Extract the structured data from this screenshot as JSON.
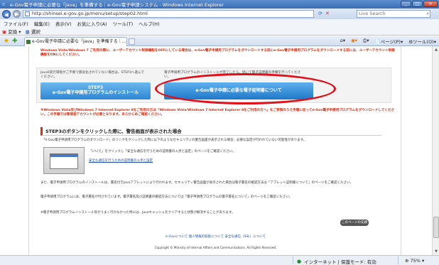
{
  "window": {
    "title": "e-Gov電子申請に必要な「Java」を準備する｜e-Gov電子申請システム - Windows Internet Explorer",
    "minimize": "_",
    "maximize": "□",
    "close": "✕"
  },
  "address": {
    "url": "http://shinsei.e-gov.go.jp/menu/setup/step02.html",
    "search_placeholder": "Live Search"
  },
  "menubar": {
    "items": [
      "ファイル(F)",
      "編集(E)",
      "表示(V)",
      "お気に入り(A)",
      "ツール(T)",
      "ヘルプ(H)"
    ]
  },
  "cmdrow": {
    "convert": "変換",
    "select": "選択"
  },
  "tabs": {
    "active_label": "e-Gov電子申請に必要な「Java」を準備する｜..."
  },
  "tabtools": {
    "page": "ページ(P)",
    "tools": "ツール(O)"
  },
  "content": {
    "top_warning": "Windows Vista/Windows 7 ご利用の際に、ユーザーアカウント制御機能をOFFにしている場合は、e-Gov電子申請用プログラムをダウンロードする前にe-Gov電子申請用プログラムをダウンロードする前には、ユーザーアカウント制御機能をONにしてください。",
    "step_left_note": "Java6実行環境がご不要で無効化されていない場合は、STEP3へ進んでください。",
    "step_right_note": "電子申請用プログラムのインストールが完了したら、続いて電子証明書の準備を行ってください。",
    "step3_title": "STEP3",
    "step3_label": "e-Gov電子申請用プログラムのインストール",
    "cert_label": "e-Gov電子申請に必要な電子証明書について",
    "mid_warning": "※Windows Vista及びWindows 7 Internet Explorer 8をご利用の方は「Windows Vista/Windows 7 Internet Explorer 8をご利用の方へ」をご参照のうえ手順に従ってe-Gov電子申請用プログラムをダウンロードしてください。この手順では管理者アカウントが必要となります。あらかじめご確認ください。",
    "section_heading": "STEP3のボタンをクリックした際に、警告画面が表示された場合",
    "p1": "「e-Gov電子申請用プログラムのダウンロード」のリンクをクリックした際に以下のようなセキュリティの警告画面が表示される場合、必要な設定が行われていない可能性があります。",
    "thumb_caption": "「いいえ」をクリックし「安全な通信を行うための証明書の入手と設定」のページをご確認ください。",
    "thumb_link": "安全な通信を行うための証明書の入手と設定",
    "p2": "また、電子申請用プログラムのインストールは、署名付きJavaアプレットにより行われます。セキュリティ警告画面が表示された場合は電子署名の確認方法は「アプレット証明書について」のページをご確認ください。",
    "p3": "電子申請用プログラムには、電子署名が付されています。電子署名及び証明書の確認方法については「電子申請用プログラムの電子署名について」のページをご確認ください。",
    "p4": "※電子申請用プログラムインストール等がうまく行かなかった時には、Javaキャッシュをクリアすると状態が解消することがあります。",
    "pagetop": "このページの先頭へ",
    "footer_links": "e-Govについて  個人情報の取扱について  安全な通信（SSL）について",
    "copyright": "Copyright © Ministry of Internal Affairs and Communications. All Rights Reserved."
  },
  "status": {
    "zone": "インターネット | 保護モード: 有効",
    "zoom": "75%"
  }
}
